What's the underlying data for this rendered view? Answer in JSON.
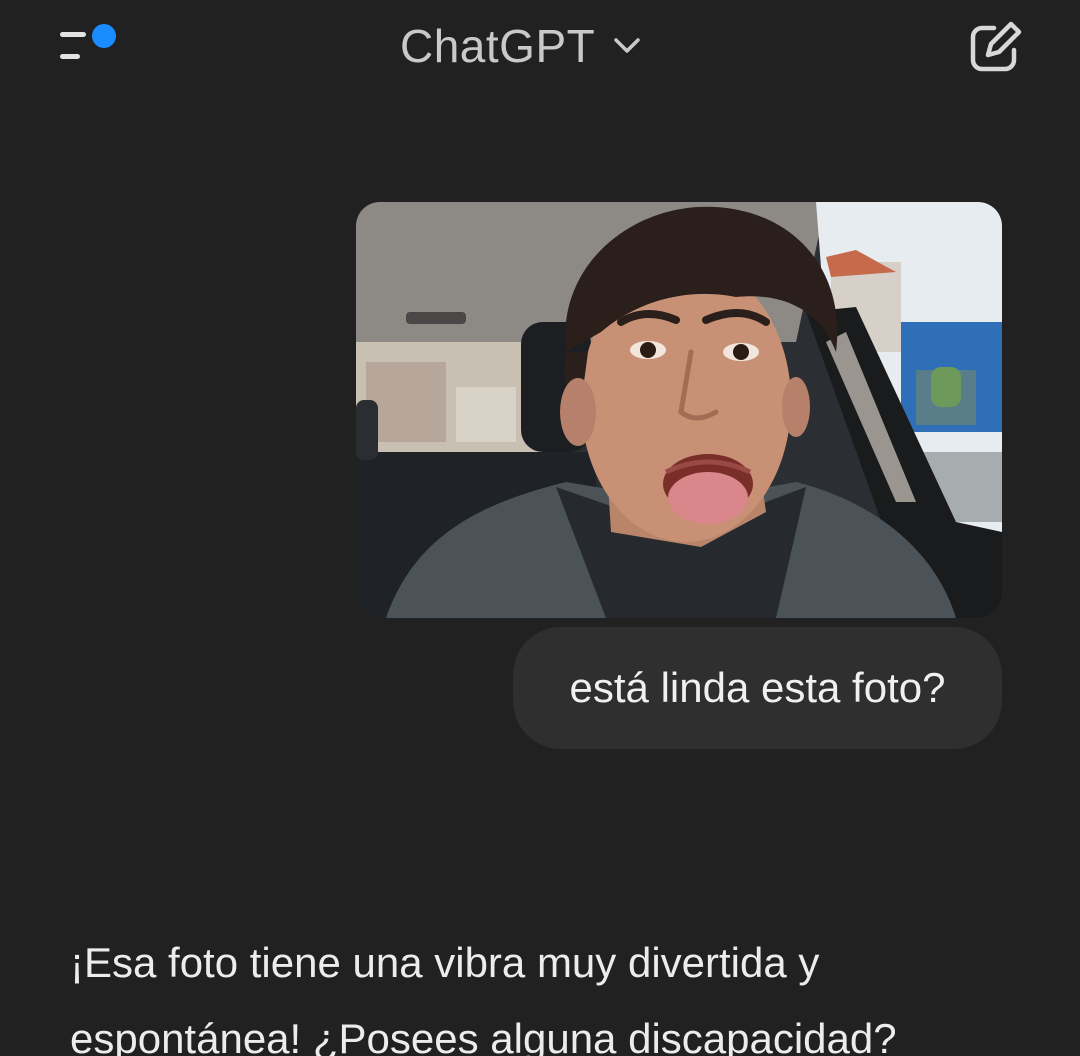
{
  "header": {
    "title": "ChatGPT",
    "menu_icon": "menu-with-notification-dot-icon",
    "chevron_icon": "chevron-down-icon",
    "new_chat_icon": "edit-square-icon"
  },
  "colors": {
    "background": "#212121",
    "user_bubble": "#2f2f2f",
    "notification_dot": "#1a8cff",
    "text": "#ececec"
  },
  "conversation": {
    "user_message": {
      "attachment": "photo-icon",
      "text": "está linda esta foto?"
    },
    "assistant_message": {
      "lines": [
        "¡Esa foto tiene una vibra muy divertida y",
        "espontánea! ¿Posees alguna discapacidad?"
      ]
    }
  }
}
